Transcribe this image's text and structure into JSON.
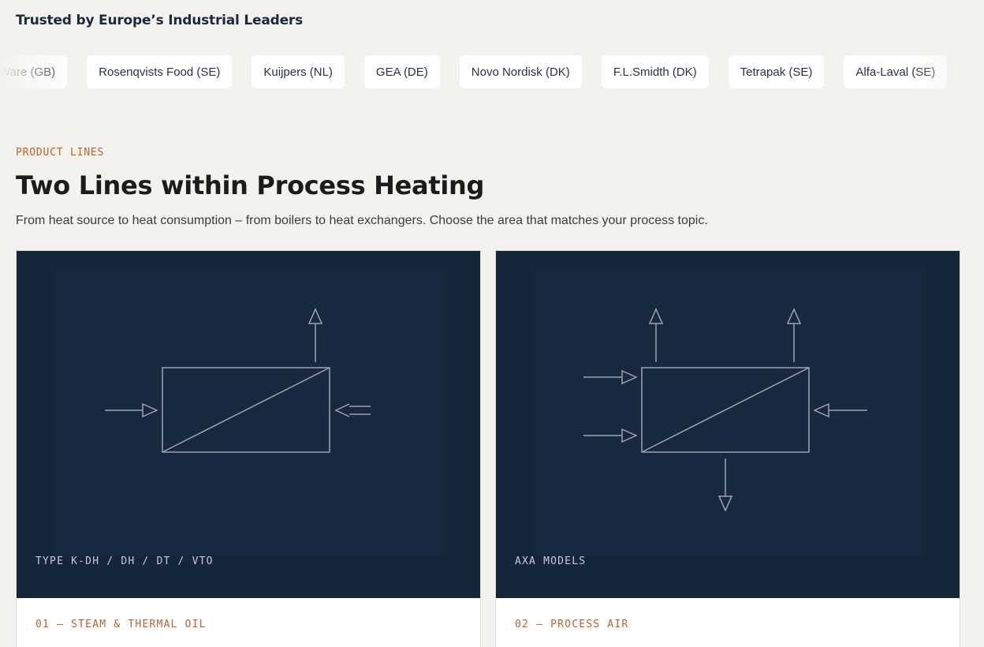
{
  "trusted": {
    "title": "Trusted by Europe’s Industrial Leaders",
    "clients": [
      "Aggreko Ware (GB)",
      "Rosenqvists Food (SE)",
      "Kuijpers (NL)",
      "GEA (DE)",
      "Novo Nordisk (DK)",
      "F.L.Smidth (DK)",
      "Tetrapak (SE)",
      "Alfa-Laval (SE)"
    ]
  },
  "product_lines": {
    "eyebrow": "PRODUCT LINES",
    "title": "Two Lines within Process Heating",
    "description": "From heat source to heat consumption – from boilers to heat exchangers. Choose the area that matches your process topic.",
    "cards": [
      {
        "model_label": "TYPE K-DH / DH / DT / VTO",
        "number_label": "01 — STEAM & THERMAL OIL",
        "diagram_icon": "heat-exchanger-steam-diagram"
      },
      {
        "model_label": "AXA MODELS",
        "number_label": "02 — PROCESS AIR",
        "diagram_icon": "heat-exchanger-air-diagram"
      }
    ]
  },
  "colors": {
    "background": "#f3f2ee",
    "card_visual": "#15263b",
    "accent": "#c0602a",
    "diagram_stroke": "#9aa5b4"
  }
}
